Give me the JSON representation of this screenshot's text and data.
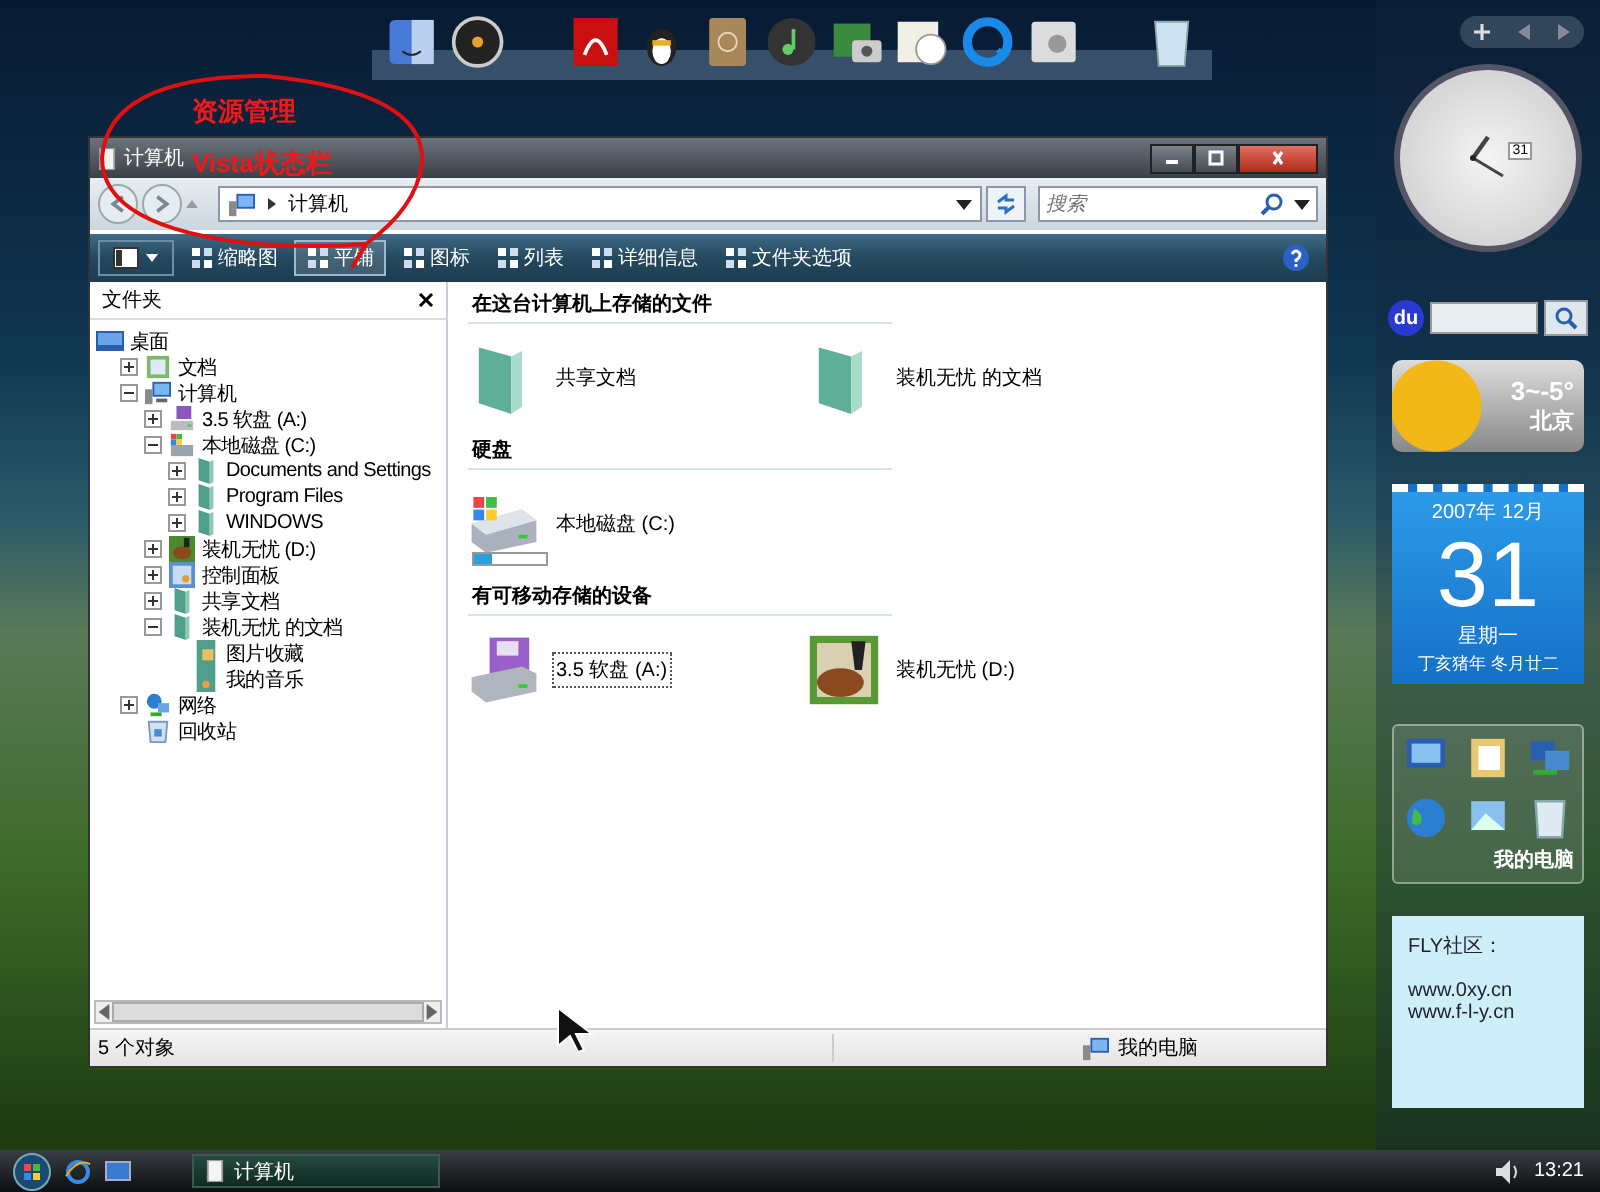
{
  "annotation": {
    "lines": [
      "资源管理",
      "Vista状态栏"
    ]
  },
  "window": {
    "title": "计算机",
    "address": {
      "crumb": "计算机"
    },
    "search": {
      "placeholder": "搜索"
    },
    "toolbar": [
      {
        "label": "缩略图",
        "selected": false
      },
      {
        "label": "平铺",
        "selected": true
      },
      {
        "label": "图标",
        "selected": false
      },
      {
        "label": "列表",
        "selected": false
      },
      {
        "label": "详细信息",
        "selected": false
      },
      {
        "label": "文件夹选项",
        "selected": false
      }
    ],
    "folder_pane": {
      "title": "文件夹",
      "root": {
        "label": "桌面",
        "kind": "desktop"
      },
      "tree": [
        {
          "label": "文档",
          "kind": "documents",
          "expanded": false
        },
        {
          "label": "计算机",
          "kind": "computer",
          "expanded": true,
          "children": [
            {
              "label": "3.5 软盘 (A:)",
              "kind": "floppy",
              "expanded": false
            },
            {
              "label": "本地磁盘 (C:)",
              "kind": "drive",
              "expanded": true,
              "children": [
                {
                  "label": "Documents and Settings",
                  "kind": "folder",
                  "expanded": false
                },
                {
                  "label": "Program Files",
                  "kind": "folder",
                  "expanded": false
                },
                {
                  "label": "WINDOWS",
                  "kind": "folder",
                  "expanded": false
                }
              ]
            },
            {
              "label": "装机无忧 (D:)",
              "kind": "removable",
              "expanded": false
            },
            {
              "label": "控制面板",
              "kind": "control-panel",
              "expanded": false
            },
            {
              "label": "共享文档",
              "kind": "folder",
              "expanded": false
            },
            {
              "label": "装机无忧 的文档",
              "kind": "folder",
              "expanded": true,
              "children": [
                {
                  "label": "图片收藏",
                  "kind": "pictures"
                },
                {
                  "label": "我的音乐",
                  "kind": "music"
                }
              ]
            }
          ]
        },
        {
          "label": "网络",
          "kind": "network",
          "expanded": false
        },
        {
          "label": "回收站",
          "kind": "recycle-bin"
        }
      ]
    },
    "sections": [
      {
        "title": "在这台计算机上存储的文件",
        "items": [
          {
            "label": "共享文档",
            "kind": "folder",
            "selected": false
          },
          {
            "label": "装机无忧 的文档",
            "kind": "folder",
            "selected": false
          }
        ]
      },
      {
        "title": "硬盘",
        "items": [
          {
            "label": "本地磁盘 (C:)",
            "kind": "drive",
            "selected": false,
            "level": 0.25
          }
        ]
      },
      {
        "title": "有可移动存储的设备",
        "items": [
          {
            "label": "3.5 软盘 (A:)",
            "kind": "floppy",
            "selected": true
          },
          {
            "label": "装机无忧 (D:)",
            "kind": "removable",
            "selected": false
          }
        ]
      }
    ],
    "status_bar": {
      "count": "5 个对象",
      "location": "我的电脑"
    }
  },
  "sidebar": {
    "clock_date": "31",
    "search_logo": "du",
    "weather": {
      "temperature": "3~-5°",
      "city": "北京"
    },
    "calendar": {
      "month": "2007年 12月",
      "day": "31",
      "weekday": "星期一",
      "lunar": "丁亥猪年 冬月廿二"
    },
    "shortcuts": {
      "label": "我的电脑"
    },
    "note": {
      "heading": "FLY社区：",
      "lines": [
        "www.0xy.cn",
        "www.f-l-y.cn"
      ]
    }
  },
  "taskbar": {
    "task": "计算机",
    "time": "13:21"
  }
}
